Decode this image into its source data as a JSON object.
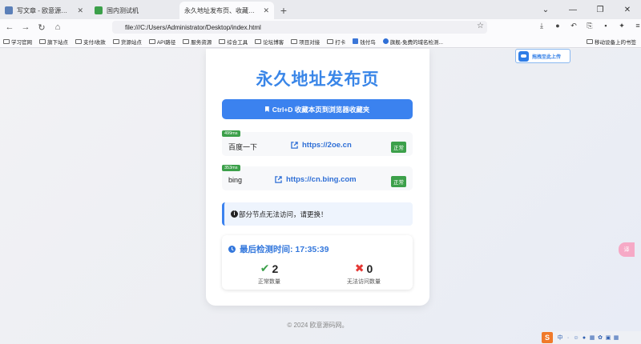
{
  "browser": {
    "tabs": [
      {
        "label": "写文章 - 欧意源码网 — Word",
        "favicon_color": "#5b7fb8",
        "active": false
      },
      {
        "label": "国内测试机",
        "favicon_color": "#3ca04a",
        "active": false
      },
      {
        "label": "永久地址发布页、收藏我回家不迷",
        "favicon_color": "",
        "active": true
      }
    ],
    "url": "file:///C:/Users/Administrator/Desktop/index.html",
    "bookmarks": [
      {
        "label": "学习官网",
        "type": "folder"
      },
      {
        "label": "旗下站点",
        "type": "folder"
      },
      {
        "label": "支付/收款",
        "type": "folder"
      },
      {
        "label": "货源站点",
        "type": "folder"
      },
      {
        "label": "API路径",
        "type": "folder"
      },
      {
        "label": "服务资源",
        "type": "folder"
      },
      {
        "label": "综合工具",
        "type": "folder"
      },
      {
        "label": "论坛博客",
        "type": "folder"
      },
      {
        "label": "项目对接",
        "type": "folder"
      },
      {
        "label": "打卡",
        "type": "folder"
      },
      {
        "label": "钱付鸟",
        "type": "site"
      },
      {
        "label": "旗舰-免费的域名检测...",
        "type": "site"
      }
    ],
    "bookmarks_right": "移动设备上的书签"
  },
  "page": {
    "title": "永久地址发布页",
    "bookmark_button": "Ctrl+D 收藏本页到浏览器收藏夹",
    "sites": [
      {
        "name": "百度一下",
        "latency": "499ms",
        "link": "https://2oe.cn",
        "status": "正常"
      },
      {
        "name": "bing",
        "latency": "353ms",
        "link": "https://cn.bing.com",
        "status": "正常"
      }
    ],
    "notice": "部分节点无法访问，请更换！",
    "last_check_label": "最后检测时间: 17:35:39",
    "stats": {
      "ok_count": "2",
      "ok_label": "正常数量",
      "fail_count": "0",
      "fail_label": "无法访问数量"
    },
    "footer": "© 2024 欧意源码网。",
    "upload_button": "拖拽至此上传",
    "side_tool_label": "译"
  },
  "colors": {
    "accent": "#3b82ef",
    "success": "#3ca04a",
    "error": "#e53935"
  }
}
